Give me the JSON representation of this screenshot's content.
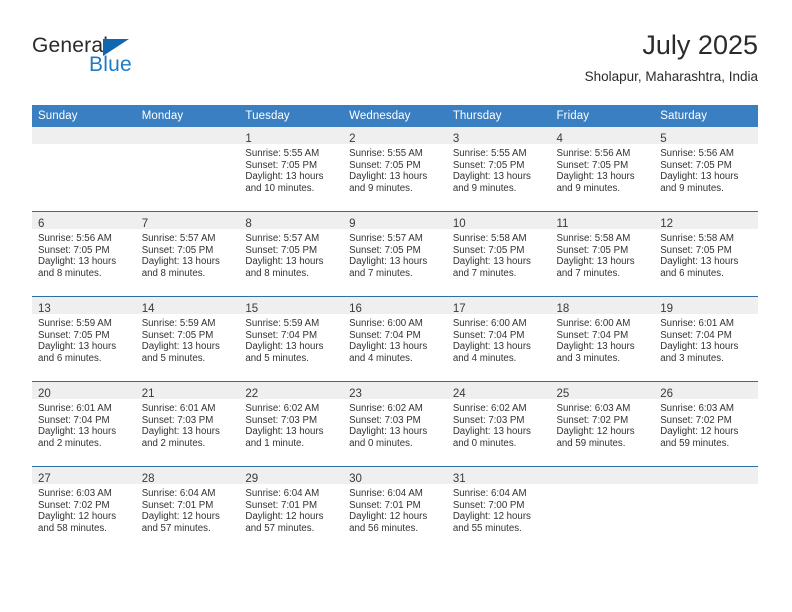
{
  "brand": {
    "name_part1": "General",
    "name_part2": "Blue",
    "triangle_color": "#1266b0",
    "blue_color": "#1e7bc8"
  },
  "header": {
    "title": "July 2025",
    "location": "Sholapur, Maharashtra, India"
  },
  "theme": {
    "header_bg": "#3a7fc1",
    "row_divider": "#2e6da8",
    "day_band_bg": "#efefef"
  },
  "weekdays": [
    "Sunday",
    "Monday",
    "Tuesday",
    "Wednesday",
    "Thursday",
    "Friday",
    "Saturday"
  ],
  "weeks": [
    [
      {
        "day": "",
        "lines": []
      },
      {
        "day": "",
        "lines": []
      },
      {
        "day": "1",
        "lines": [
          "Sunrise: 5:55 AM",
          "Sunset: 7:05 PM",
          "Daylight: 13 hours",
          "and 10 minutes."
        ]
      },
      {
        "day": "2",
        "lines": [
          "Sunrise: 5:55 AM",
          "Sunset: 7:05 PM",
          "Daylight: 13 hours",
          "and 9 minutes."
        ]
      },
      {
        "day": "3",
        "lines": [
          "Sunrise: 5:55 AM",
          "Sunset: 7:05 PM",
          "Daylight: 13 hours",
          "and 9 minutes."
        ]
      },
      {
        "day": "4",
        "lines": [
          "Sunrise: 5:56 AM",
          "Sunset: 7:05 PM",
          "Daylight: 13 hours",
          "and 9 minutes."
        ]
      },
      {
        "day": "5",
        "lines": [
          "Sunrise: 5:56 AM",
          "Sunset: 7:05 PM",
          "Daylight: 13 hours",
          "and 9 minutes."
        ]
      }
    ],
    [
      {
        "day": "6",
        "lines": [
          "Sunrise: 5:56 AM",
          "Sunset: 7:05 PM",
          "Daylight: 13 hours",
          "and 8 minutes."
        ]
      },
      {
        "day": "7",
        "lines": [
          "Sunrise: 5:57 AM",
          "Sunset: 7:05 PM",
          "Daylight: 13 hours",
          "and 8 minutes."
        ]
      },
      {
        "day": "8",
        "lines": [
          "Sunrise: 5:57 AM",
          "Sunset: 7:05 PM",
          "Daylight: 13 hours",
          "and 8 minutes."
        ]
      },
      {
        "day": "9",
        "lines": [
          "Sunrise: 5:57 AM",
          "Sunset: 7:05 PM",
          "Daylight: 13 hours",
          "and 7 minutes."
        ]
      },
      {
        "day": "10",
        "lines": [
          "Sunrise: 5:58 AM",
          "Sunset: 7:05 PM",
          "Daylight: 13 hours",
          "and 7 minutes."
        ]
      },
      {
        "day": "11",
        "lines": [
          "Sunrise: 5:58 AM",
          "Sunset: 7:05 PM",
          "Daylight: 13 hours",
          "and 7 minutes."
        ]
      },
      {
        "day": "12",
        "lines": [
          "Sunrise: 5:58 AM",
          "Sunset: 7:05 PM",
          "Daylight: 13 hours",
          "and 6 minutes."
        ]
      }
    ],
    [
      {
        "day": "13",
        "lines": [
          "Sunrise: 5:59 AM",
          "Sunset: 7:05 PM",
          "Daylight: 13 hours",
          "and 6 minutes."
        ]
      },
      {
        "day": "14",
        "lines": [
          "Sunrise: 5:59 AM",
          "Sunset: 7:05 PM",
          "Daylight: 13 hours",
          "and 5 minutes."
        ]
      },
      {
        "day": "15",
        "lines": [
          "Sunrise: 5:59 AM",
          "Sunset: 7:04 PM",
          "Daylight: 13 hours",
          "and 5 minutes."
        ]
      },
      {
        "day": "16",
        "lines": [
          "Sunrise: 6:00 AM",
          "Sunset: 7:04 PM",
          "Daylight: 13 hours",
          "and 4 minutes."
        ]
      },
      {
        "day": "17",
        "lines": [
          "Sunrise: 6:00 AM",
          "Sunset: 7:04 PM",
          "Daylight: 13 hours",
          "and 4 minutes."
        ]
      },
      {
        "day": "18",
        "lines": [
          "Sunrise: 6:00 AM",
          "Sunset: 7:04 PM",
          "Daylight: 13 hours",
          "and 3 minutes."
        ]
      },
      {
        "day": "19",
        "lines": [
          "Sunrise: 6:01 AM",
          "Sunset: 7:04 PM",
          "Daylight: 13 hours",
          "and 3 minutes."
        ]
      }
    ],
    [
      {
        "day": "20",
        "lines": [
          "Sunrise: 6:01 AM",
          "Sunset: 7:04 PM",
          "Daylight: 13 hours",
          "and 2 minutes."
        ]
      },
      {
        "day": "21",
        "lines": [
          "Sunrise: 6:01 AM",
          "Sunset: 7:03 PM",
          "Daylight: 13 hours",
          "and 2 minutes."
        ]
      },
      {
        "day": "22",
        "lines": [
          "Sunrise: 6:02 AM",
          "Sunset: 7:03 PM",
          "Daylight: 13 hours",
          "and 1 minute."
        ]
      },
      {
        "day": "23",
        "lines": [
          "Sunrise: 6:02 AM",
          "Sunset: 7:03 PM",
          "Daylight: 13 hours",
          "and 0 minutes."
        ]
      },
      {
        "day": "24",
        "lines": [
          "Sunrise: 6:02 AM",
          "Sunset: 7:03 PM",
          "Daylight: 13 hours",
          "and 0 minutes."
        ]
      },
      {
        "day": "25",
        "lines": [
          "Sunrise: 6:03 AM",
          "Sunset: 7:02 PM",
          "Daylight: 12 hours",
          "and 59 minutes."
        ]
      },
      {
        "day": "26",
        "lines": [
          "Sunrise: 6:03 AM",
          "Sunset: 7:02 PM",
          "Daylight: 12 hours",
          "and 59 minutes."
        ]
      }
    ],
    [
      {
        "day": "27",
        "lines": [
          "Sunrise: 6:03 AM",
          "Sunset: 7:02 PM",
          "Daylight: 12 hours",
          "and 58 minutes."
        ]
      },
      {
        "day": "28",
        "lines": [
          "Sunrise: 6:04 AM",
          "Sunset: 7:01 PM",
          "Daylight: 12 hours",
          "and 57 minutes."
        ]
      },
      {
        "day": "29",
        "lines": [
          "Sunrise: 6:04 AM",
          "Sunset: 7:01 PM",
          "Daylight: 12 hours",
          "and 57 minutes."
        ]
      },
      {
        "day": "30",
        "lines": [
          "Sunrise: 6:04 AM",
          "Sunset: 7:01 PM",
          "Daylight: 12 hours",
          "and 56 minutes."
        ]
      },
      {
        "day": "31",
        "lines": [
          "Sunrise: 6:04 AM",
          "Sunset: 7:00 PM",
          "Daylight: 12 hours",
          "and 55 minutes."
        ]
      },
      {
        "day": "",
        "lines": []
      },
      {
        "day": "",
        "lines": []
      }
    ]
  ]
}
